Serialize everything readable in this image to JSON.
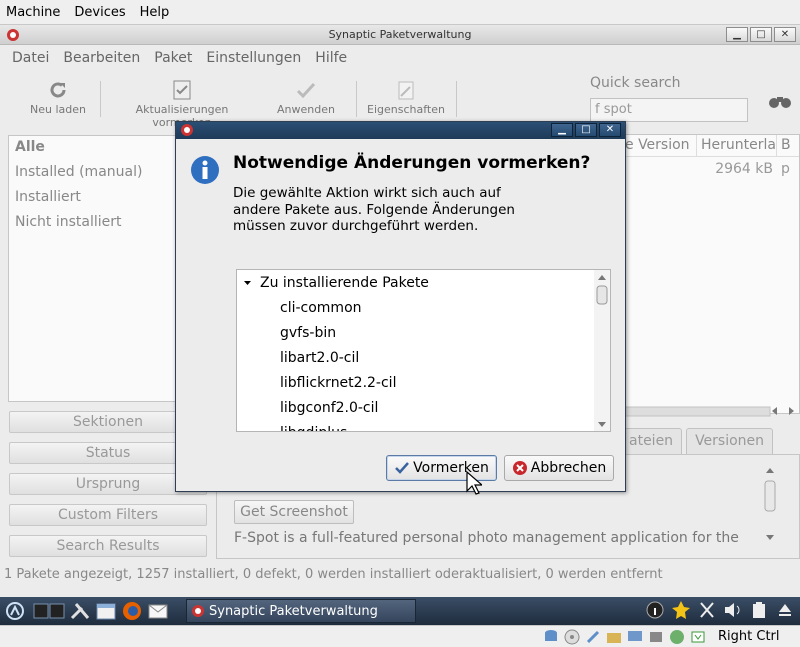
{
  "host_menu": [
    "Machine",
    "Devices",
    "Help"
  ],
  "window": {
    "title": "Synaptic Paketverwaltung"
  },
  "app_menu": [
    "Datei",
    "Bearbeiten",
    "Paket",
    "Einstellungen",
    "Hilfe"
  ],
  "toolbar": {
    "reload": "Neu laden",
    "mark_upgrades": "Aktualisierungen vormerken",
    "apply": "Anwenden",
    "properties": "Eigenschaften"
  },
  "quick_search": {
    "label": "Quick search",
    "value": "f spot"
  },
  "filters": [
    "Alle",
    "Installed (manual)",
    "Installiert",
    "Nicht installiert"
  ],
  "side_buttons": [
    "Sektionen",
    "Status",
    "Ursprung",
    "Custom Filters",
    "Search Results"
  ],
  "package_table": {
    "columns": [
      "e Version",
      "Herunterla",
      "B"
    ],
    "row": {
      "size": "2964 kB",
      "extra": "p"
    }
  },
  "detail_tabs": [
    "ateien",
    "Versionen"
  ],
  "detail": {
    "screenshot_button": "Get Screenshot",
    "description": "F-Spot is a full-featured personal photo management application for the"
  },
  "status_bar": "1 Pakete angezeigt, 1257 installiert, 0 defekt, 0 werden installiert oderaktualisiert, 0 werden entfernt",
  "taskbar": {
    "window_label": "Synaptic Paketverwaltung"
  },
  "vbox_status": {
    "host_key": "Right Ctrl"
  },
  "dialog": {
    "heading": "Notwendige Änderungen vormerken?",
    "text": "Die gewählte Aktion wirkt sich auch auf andere Pakete aus. Folgende Änderungen müssen zuvor durchgeführt werden.",
    "tree_header": "Zu installierende Pakete",
    "packages": [
      "cli-common",
      "gvfs-bin",
      "libart2.0-cil",
      "libflickrnet2.2-cil",
      "libgconf2.0-cil",
      "libgdiplus"
    ],
    "ok_button": "Vormerken",
    "cancel_button": "Abbrechen"
  }
}
